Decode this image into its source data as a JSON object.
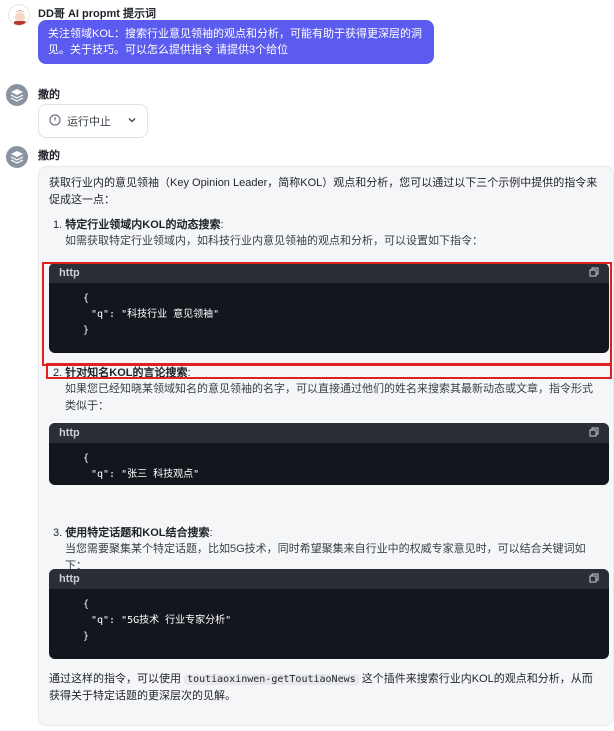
{
  "user": {
    "name": "DD哥 AI propmt 提示词",
    "message": "关注领域KOL：搜索行业意见领袖的观点和分析，可能有助于获得更深层的洞见。关于技巧。可以怎么提供指令 请提供3个给位"
  },
  "bot1": {
    "name": "撒的",
    "status_label": "运行中止"
  },
  "bot2": {
    "name": "撒的",
    "intro": "获取行业内的意见领袖（Key Opinion Leader，简称KOL）观点和分析，您可以通过以下三个示例中提供的指令来促成这一点：",
    "items": [
      {
        "number": "1.",
        "title": "特定行业领域内KOL的动态搜索",
        "desc": "如需获取特定行业领域内，如科技行业内意见领袖的观点和分析，可以设置如下指令：",
        "code_lang": "http",
        "code_open": "{",
        "code_key": "\"q\": \"科技行业 意见领袖\"",
        "code_close": "}"
      },
      {
        "number": "2.",
        "title": "针对知名KOL的言论搜索",
        "desc": "如果您已经知晓某领域知名的意见领袖的名字，可以直接通过他们的姓名来搜索其最新动态或文章，指令形式类似于：",
        "code_lang": "http",
        "code_open": "{",
        "code_key": "\"q\": \"张三 科技观点\"",
        "code_close": "}"
      },
      {
        "number": "3.",
        "title": "使用特定话题和KOL结合搜索",
        "desc": "当您需要聚集某个特定话题，比如5G技术，同时希望聚集来自行业中的权威专家意见时，可以结合关键词如下：",
        "code_lang": "http",
        "code_open": "{",
        "code_key": "\"q\": \"5G技术 行业专家分析\"",
        "code_close": "}"
      }
    ],
    "outro_before": "通过这样的指令，可以使用",
    "outro_code": "toutiaoxinwen-getToutiaoNews",
    "outro_after": "这个插件来搜索行业内KOL的观点和分析，从而获得关于特定话题的更深层次的见解。"
  },
  "colors": {
    "accent": "#5b5bf0",
    "highlight": "#e32020",
    "code_bg": "#14161d"
  }
}
